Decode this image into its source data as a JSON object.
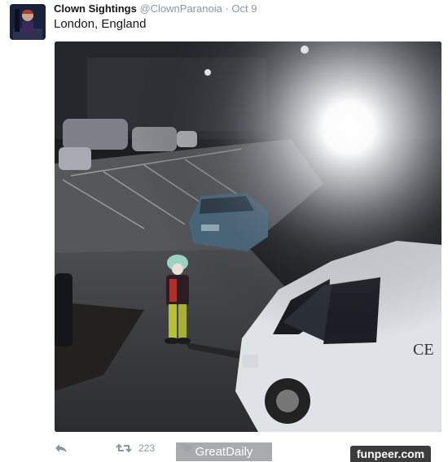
{
  "tweet": {
    "display_name": "Clown Sightings",
    "handle": "@ClownParanoia",
    "separator": "·",
    "time": "Oct 9",
    "text": "London, England"
  },
  "actions": {
    "reply_icon": "reply-icon",
    "retweet_icon": "retweet-icon",
    "retweet_count": "223",
    "like_icon": "heart-icon"
  },
  "watermarks": {
    "greatdaily": "GreatDaily",
    "funpeer": "funpeer.com"
  },
  "colors": {
    "muted": "#8899a6",
    "text": "#14171a"
  }
}
